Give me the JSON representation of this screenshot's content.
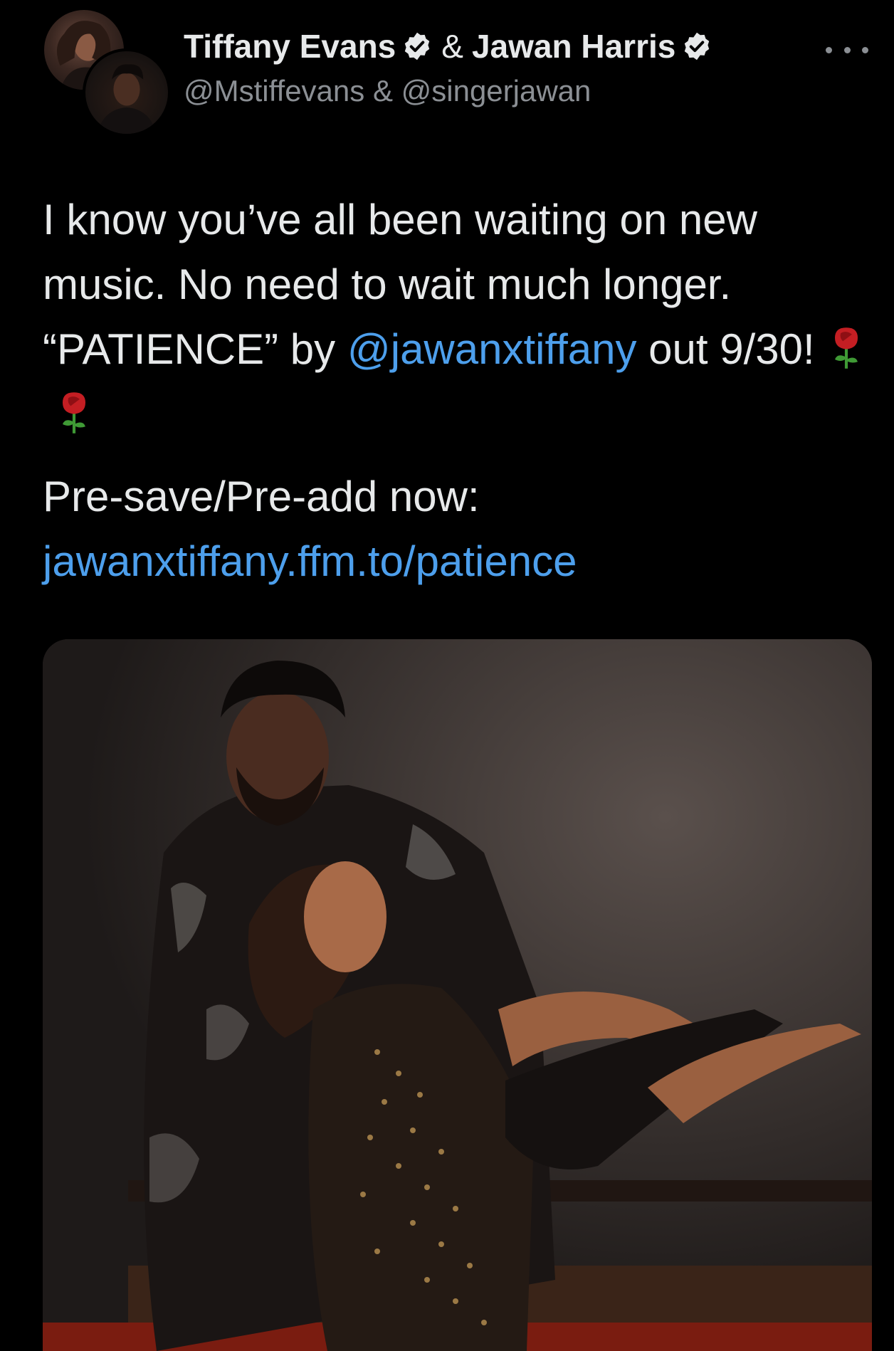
{
  "tweet": {
    "author_1": {
      "name": "Tiffany Evans",
      "verified": true,
      "handle": "@Mstiffevans"
    },
    "author_2": {
      "name": "Jawan Harris",
      "verified": true,
      "handle": "@singerjawan"
    },
    "names_joiner": "&",
    "handles_line": "@Mstiffevans & @singerjawan",
    "line_1": "I know you’ve all been waiting on new music. No need to wait much longer. “PATIENCE” by ",
    "mention": "@jawanxtiffany",
    "line_1_tail": " out 9/30!",
    "emoji": [
      "rose-emoji",
      "rose-emoji"
    ],
    "presave_label": "Pre-save/Pre-add now:",
    "presave_link": "jawanxtiffany.ffm.to/patience",
    "more_icon": "more-dots-icon",
    "verified_icon": "verified-badge-icon"
  },
  "colors": {
    "background": "#000000",
    "text": "#e7e9ea",
    "secondary_text": "#8b8f94",
    "link": "#4d9fec",
    "verified": "#e7e9ea"
  }
}
